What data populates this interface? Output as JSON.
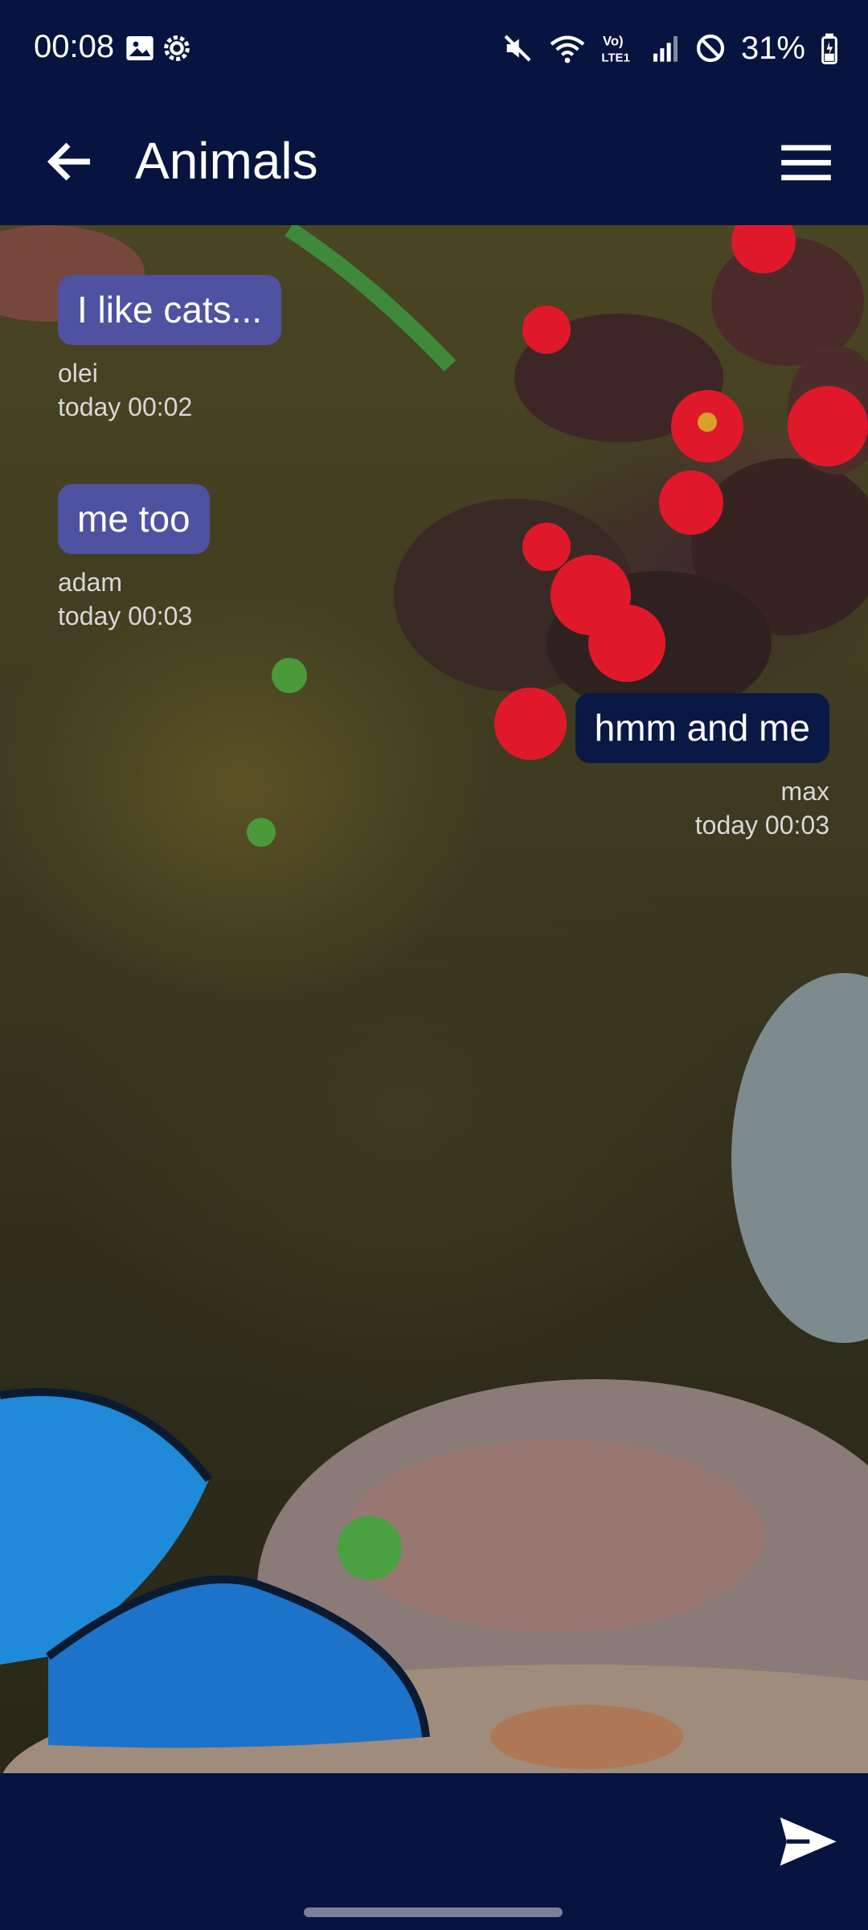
{
  "status_bar": {
    "time": "00:08",
    "battery": "31%",
    "icons": [
      "image-icon",
      "settings-icon",
      "mute-icon",
      "wifi-icon",
      "volte-icon",
      "signal-icon",
      "dnd-icon",
      "battery-icon"
    ],
    "network_label": "Vo) LTE1"
  },
  "app_bar": {
    "title": "Animals",
    "back_icon": "arrow-left-icon",
    "menu_icon": "hamburger-menu-icon"
  },
  "messages": [
    {
      "text": "I like cats...",
      "author": "olei",
      "time": "today 00:02",
      "mine": false
    },
    {
      "text": "me too",
      "author": "adam",
      "time": "today 00:03",
      "mine": false
    },
    {
      "text": "hmm and me",
      "author": "max",
      "time": "today 00:03",
      "mine": true
    }
  ],
  "composer": {
    "send_icon": "send-icon"
  },
  "colors": {
    "bar_background": "#07143f",
    "bubble_other": "#4f52a0",
    "bubble_mine": "#0a1845"
  }
}
